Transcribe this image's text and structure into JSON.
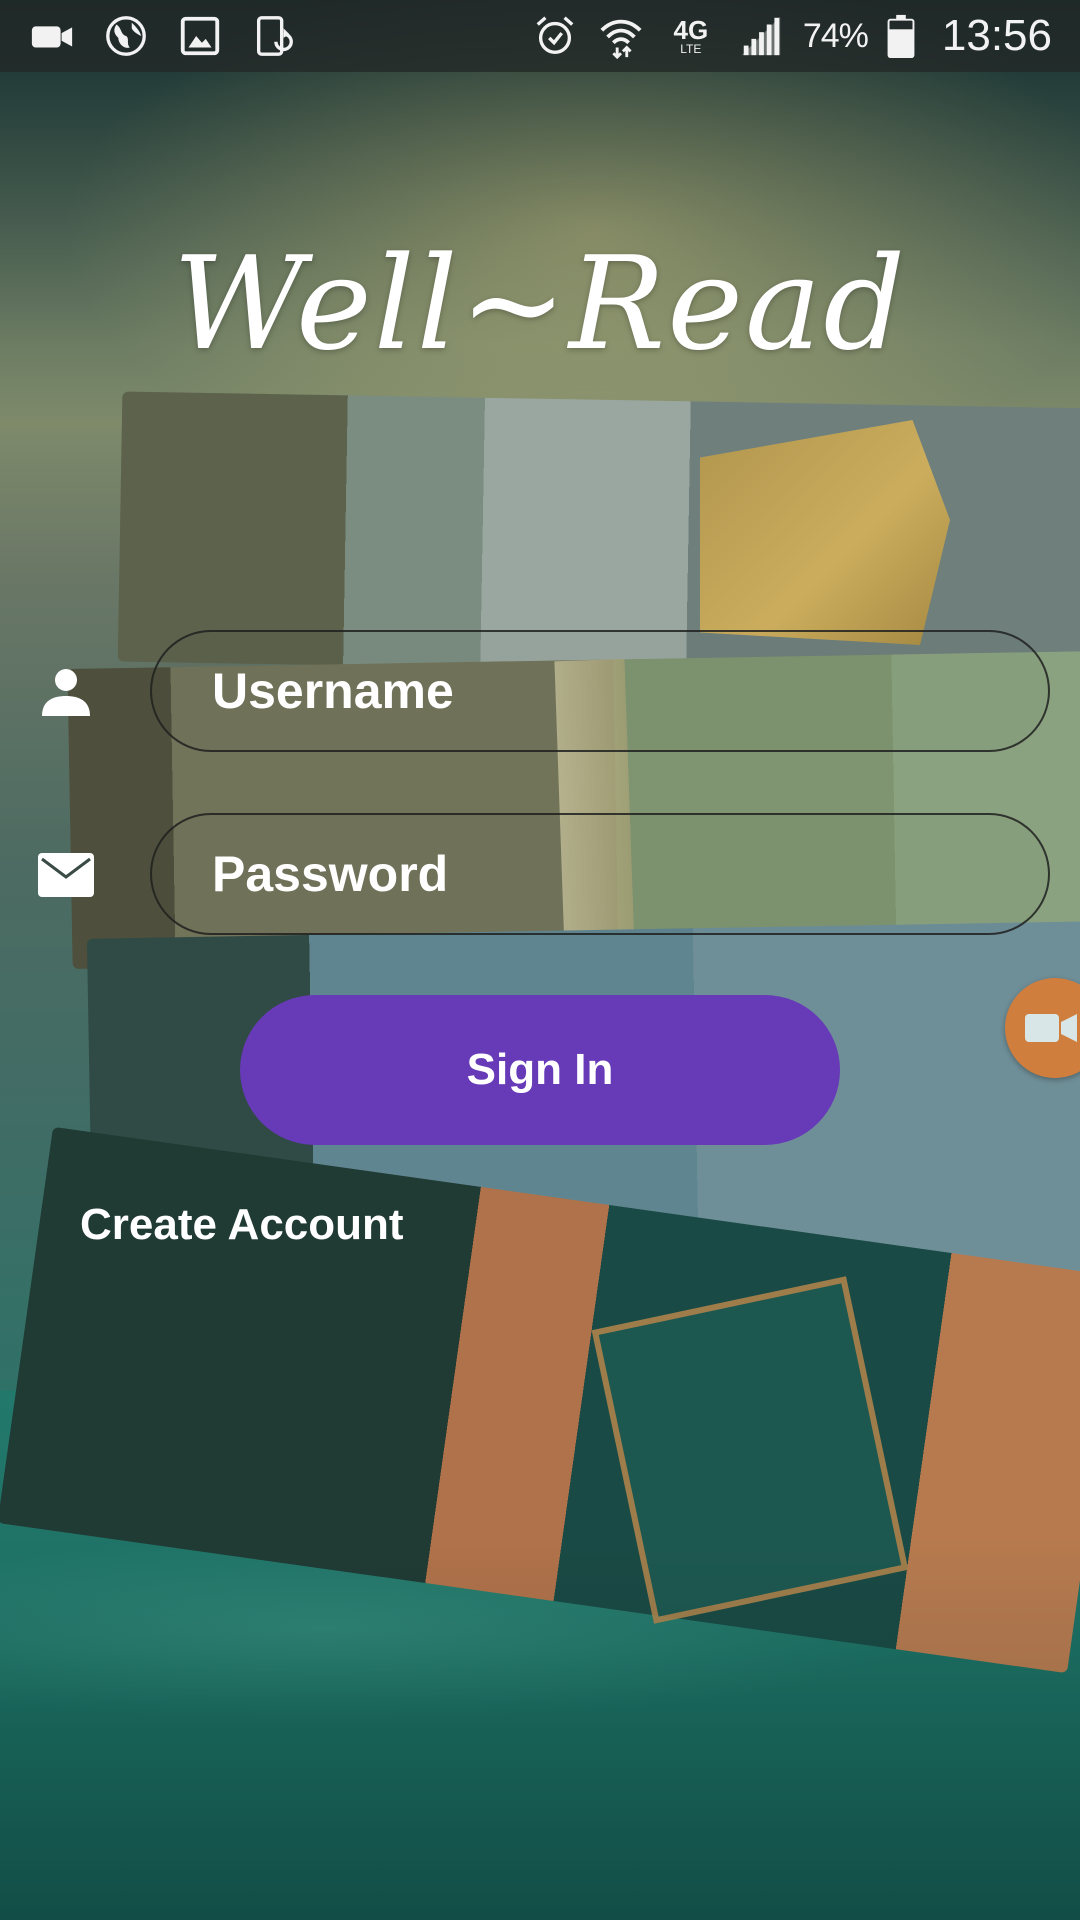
{
  "status_bar": {
    "left_icons": [
      "video-camera-icon",
      "globe-icon",
      "image-icon",
      "screen-rotation-icon"
    ],
    "right_icons": [
      "alarm-icon",
      "wifi-icon",
      "lte-icon",
      "signal-icon",
      "battery-icon"
    ],
    "network": "4G",
    "network_sub": "LTE",
    "battery": "74%",
    "time": "13:56"
  },
  "logo": {
    "text": "Well~Read"
  },
  "form": {
    "username_placeholder": "Username",
    "password_placeholder": "Password",
    "username_icon": "person-icon",
    "password_icon": "envelope-icon"
  },
  "actions": {
    "sign_in_label": "Sign In",
    "create_account_label": "Create Account"
  },
  "overlay": {
    "floating_icon": "video-camera-icon"
  },
  "colors": {
    "accent": "#673ab7",
    "floating_bubble": "#d07e3e",
    "text": "#ffffff",
    "status_bar": "#23282699"
  }
}
